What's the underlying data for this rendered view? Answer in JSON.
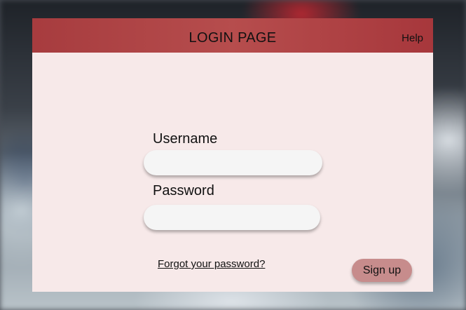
{
  "header": {
    "title": "LOGIN PAGE",
    "help_label": "Help"
  },
  "form": {
    "username_label": "Username",
    "username_value": "",
    "password_label": "Password",
    "password_value": "",
    "forgot_label": "Forgot your password?",
    "signup_label": "Sign up"
  },
  "colors": {
    "header": "#a32d30",
    "panel": "#f7e9e9",
    "signup_button": "#c78c8c",
    "input": "#f5f5f5"
  }
}
